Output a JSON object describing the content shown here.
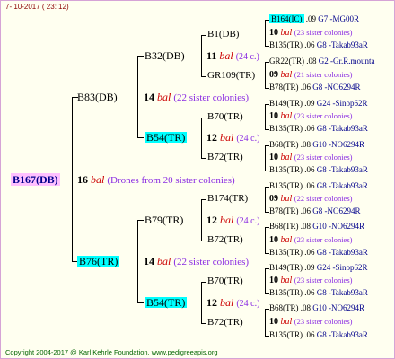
{
  "header": {
    "date": "7- 10-2017 ( 23: 12)"
  },
  "footer": {
    "copyright": "Copyright 2004-2017 @ Karl Kehrle Foundation.   www.pedigreeapis.org"
  },
  "root": {
    "name": "B167(DB)",
    "count": "16",
    "bal": "bal",
    "note": "(Drones from 20 sister colonies)"
  },
  "gen1": [
    {
      "name": "B83(DB)",
      "count": "14",
      "bal": "bal",
      "sis": "(22 sister colonies)"
    },
    {
      "name": "B76(TR)",
      "count": "14",
      "bal": "bal",
      "sis": "(22 sister colonies)"
    }
  ],
  "gen2": [
    {
      "name": "B32(DB)",
      "count": "11",
      "bal": "bal",
      "sis": "(24 c.)"
    },
    {
      "name": "B54(TR)",
      "count": "12",
      "bal": "bal",
      "sis": "(24 c.)"
    },
    {
      "name": "B79(TR)",
      "count": "12",
      "bal": "bal",
      "sis": "(24 c.)"
    },
    {
      "name": "B54(TR)",
      "count": "12",
      "bal": "bal",
      "sis": "(24 c.)"
    }
  ],
  "gen3": [
    {
      "name": "B1(DB)",
      "count": "10",
      "bal": "bal",
      "sis": "(23 sister colonies)"
    },
    {
      "name": "GR109(TR)",
      "count": "09",
      "bal": "bal",
      "sis": "(21 sister colonies)"
    },
    {
      "name": "B70(TR)",
      "count": "10",
      "bal": "bal",
      "sis": "(23 sister colonies)"
    },
    {
      "name": "B72(TR)",
      "count": "10",
      "bal": "bal",
      "sis": "(23 sister colonies)"
    },
    {
      "name": "B174(TR)",
      "count": "09",
      "bal": "bal",
      "sis": "(22 sister colonies)"
    },
    {
      "name": "B72(TR)",
      "count": "10",
      "bal": "bal",
      "sis": "(23 sister colonies)"
    },
    {
      "name": "B70(TR)",
      "count": "10",
      "bal": "bal",
      "sis": "(23 sister colonies)"
    },
    {
      "name": "B72(TR)",
      "count": "10",
      "bal": "bal",
      "sis": "(23 sister colonies)"
    }
  ],
  "gen4": [
    {
      "name": "B164(IC)",
      "year": ".09",
      "info": "G7 -MG00R"
    },
    {
      "name": "B135(TR)",
      "year": ".06",
      "info": "G8 -Takab93aR"
    },
    {
      "name": "GR22(TR)",
      "year": ".08",
      "info": "G2 -Gr.R.mounta"
    },
    {
      "name": "B78(TR)",
      "year": ".06",
      "info": "G8 -NO6294R"
    },
    {
      "name": "B149(TR)",
      "year": ".09",
      "info": "G24 -Sinop62R"
    },
    {
      "name": "B135(TR)",
      "year": ".06",
      "info": "G8 -Takab93aR"
    },
    {
      "name": "B68(TR)",
      "year": ".08",
      "info": "G10 -NO6294R"
    },
    {
      "name": "B135(TR)",
      "year": ".06",
      "info": "G8 -Takab93aR"
    },
    {
      "name": "B135(TR)",
      "year": ".06",
      "info": "G8 -Takab93aR"
    },
    {
      "name": "B78(TR)",
      "year": ".06",
      "info": "G8 -NO6294R"
    },
    {
      "name": "B68(TR)",
      "year": ".08",
      "info": "G10 -NO6294R"
    },
    {
      "name": "B135(TR)",
      "year": ".06",
      "info": "G8 -Takab93aR"
    },
    {
      "name": "B149(TR)",
      "year": ".09",
      "info": "G24 -Sinop62R"
    },
    {
      "name": "B135(TR)",
      "year": ".06",
      "info": "G8 -Takab93aR"
    },
    {
      "name": "B68(TR)",
      "year": ".08",
      "info": "G10 -NO6294R"
    },
    {
      "name": "B135(TR)",
      "year": ".06",
      "info": "G8 -Takab93aR"
    }
  ]
}
